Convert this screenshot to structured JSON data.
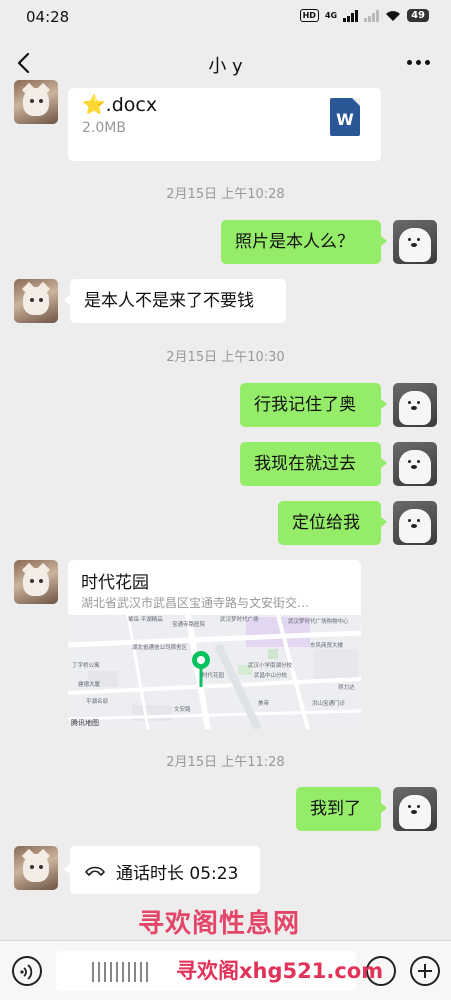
{
  "status_bar": {
    "time": "04:28",
    "hd": "HD",
    "network": "4G",
    "battery": "49",
    "icons": [
      "signal-icon",
      "wifi-icon",
      "battery-icon"
    ]
  },
  "header": {
    "title": "小 y",
    "back_icon": "chevron-left-icon",
    "more_icon": "more-dots-icon"
  },
  "messages": {
    "file": {
      "star": "⭐",
      "name": ".docx",
      "size": "2.0MB",
      "file_type_icon": "W"
    },
    "sep1": "2月15日 上午10:28",
    "m1": "照片是本人么？",
    "m2": "是本人不是来了不要钱",
    "sep2": "2月15日 上午10:30",
    "m3": "行我记住了奥",
    "m4": "我现在就过去",
    "m5": "定位给我",
    "location": {
      "name": "时代花园",
      "address": "湖北省武汉市武昌区宝通寺路与文安街交…",
      "map_labels": {
        "l1": "紫岳·平湖精品",
        "l2": "宝通寺路医院",
        "l3": "武汉梦时代广场",
        "l4": "武汉梦时代广场购物中心",
        "l5": "湖北省通信公司宿舍区",
        "l6": "丁字桥公寓",
        "l7": "建德大厦",
        "l8": "时代花园",
        "l9": "武汉小学南湖分校",
        "l10": "东风商贸大楼",
        "l11": "武昌中山分校",
        "l12": "洪山宝通门诊",
        "l13": "平湖名邸",
        "l14": "文安路",
        "l15": "美帝",
        "l16": "得力达"
      },
      "map_attribution": "腾讯地图"
    },
    "sep3": "2月15日 上午11:28",
    "m6": "我到了",
    "call": "通话时长 05:23"
  },
  "watermark": {
    "line1": "寻欢阁性息网",
    "line2": "寻欢阁xhg521.com"
  },
  "colors": {
    "background": "#ededed",
    "outgoing_bubble": "#95ec69",
    "incoming_bubble": "#ffffff",
    "watermark": "#e2345a",
    "map_pin": "#07c160"
  }
}
